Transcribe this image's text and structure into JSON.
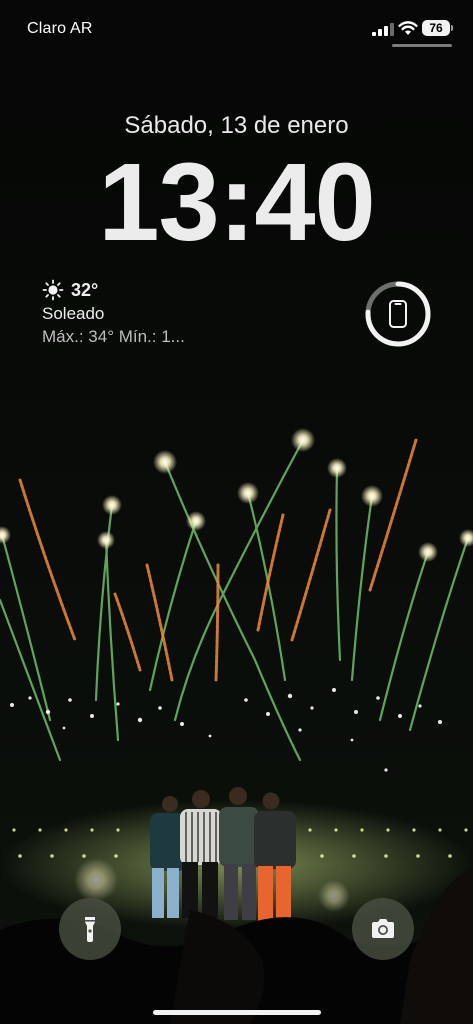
{
  "status_bar": {
    "carrier": "Claro AR",
    "battery_level": "76",
    "signal_icon": "cellular-signal-icon",
    "wifi_icon": "wifi-icon"
  },
  "lock_screen": {
    "date": "Sábado, 13 de enero",
    "time": "13:40"
  },
  "weather_widget": {
    "icon": "sun-icon",
    "temperature": "32°",
    "condition": "Soleado",
    "range": "Máx.: 34° Mín.: 1..."
  },
  "battery_widget": {
    "icon": "phone-icon"
  },
  "quick_actions": {
    "flashlight_icon": "flashlight-icon",
    "camera_icon": "camera-icon"
  },
  "colors": {
    "sky": "#060806",
    "firework_green": "#7ed37a",
    "firework_orange": "#f08a3a",
    "stage_glow": "#c9e68a"
  }
}
